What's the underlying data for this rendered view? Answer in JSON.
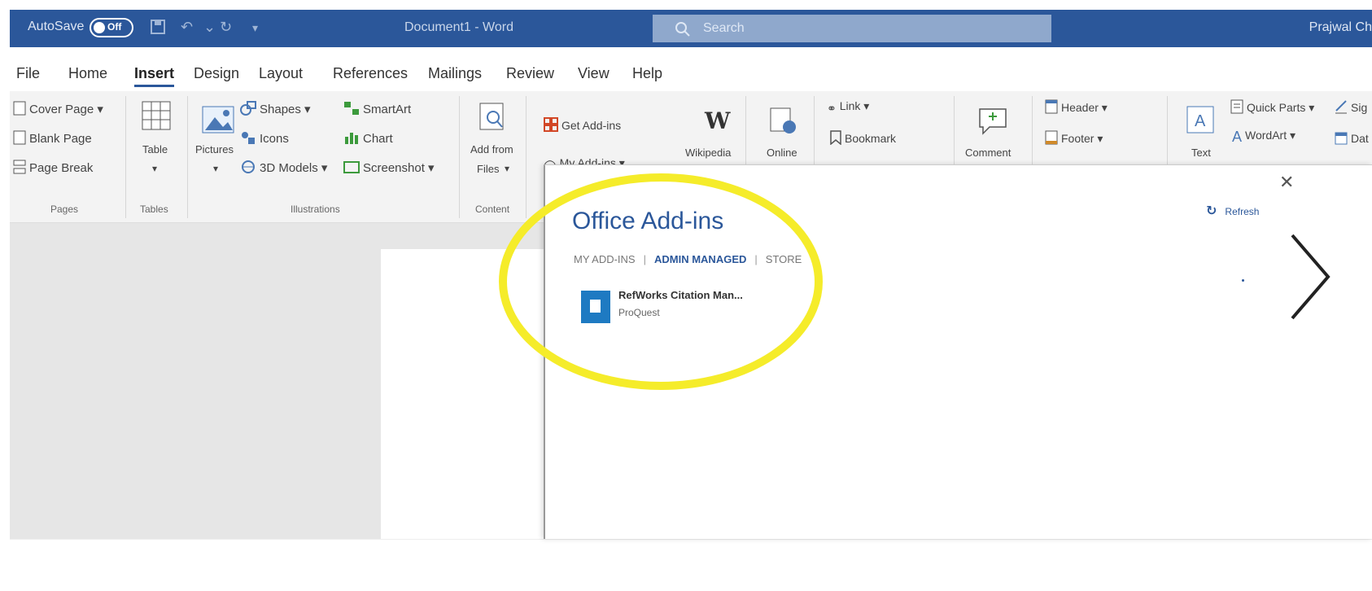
{
  "window": {
    "autosave_label": "AutoSave",
    "autosave_state": "Off",
    "title": "Document1 - Word",
    "search_placeholder": "Search",
    "user_name": "Prajwal Ch"
  },
  "tabs": [
    "File",
    "Home",
    "Insert",
    "Design",
    "Layout",
    "References",
    "Mailings",
    "Review",
    "View",
    "Help"
  ],
  "active_tab": "Insert",
  "ribbon": {
    "pages": {
      "label": "Pages",
      "items": [
        "Cover Page",
        "Blank Page",
        "Page Break"
      ]
    },
    "tables": {
      "label": "Tables",
      "table": "Table"
    },
    "illustrations": {
      "label": "Illustrations",
      "pictures": "Pictures",
      "shapes": "Shapes",
      "icons": "Icons",
      "models": "3D Models",
      "smartart": "SmartArt",
      "chart": "Chart",
      "screenshot": "Screenshot"
    },
    "content": {
      "label": "Content",
      "add_from_files_1": "Add from",
      "add_from_files_2": "Files"
    },
    "addins": {
      "get": "Get Add-ins",
      "my": "My Add-ins",
      "wikipedia": "Wikipedia",
      "online": "Online"
    },
    "links": {
      "link": "Link",
      "bookmark": "Bookmark"
    },
    "comments": {
      "comment": "Comment"
    },
    "header_footer": {
      "header": "Header",
      "footer": "Footer"
    },
    "text": {
      "text": "Text",
      "quick_parts": "Quick Parts",
      "wordart": "WordArt",
      "signature": "Sig",
      "date": "Dat"
    }
  },
  "addins_panel": {
    "title": "Office Add-ins",
    "refresh": "Refresh",
    "nav": {
      "my": "MY ADD-INS",
      "admin": "ADMIN MANAGED",
      "store": "STORE"
    },
    "items": [
      {
        "name": "RefWorks Citation Man...",
        "publisher": "ProQuest"
      }
    ]
  },
  "colors": {
    "brand": "#2b579a",
    "highlight": "#f5ec2a",
    "addin_logo": "#1e7ac2"
  }
}
